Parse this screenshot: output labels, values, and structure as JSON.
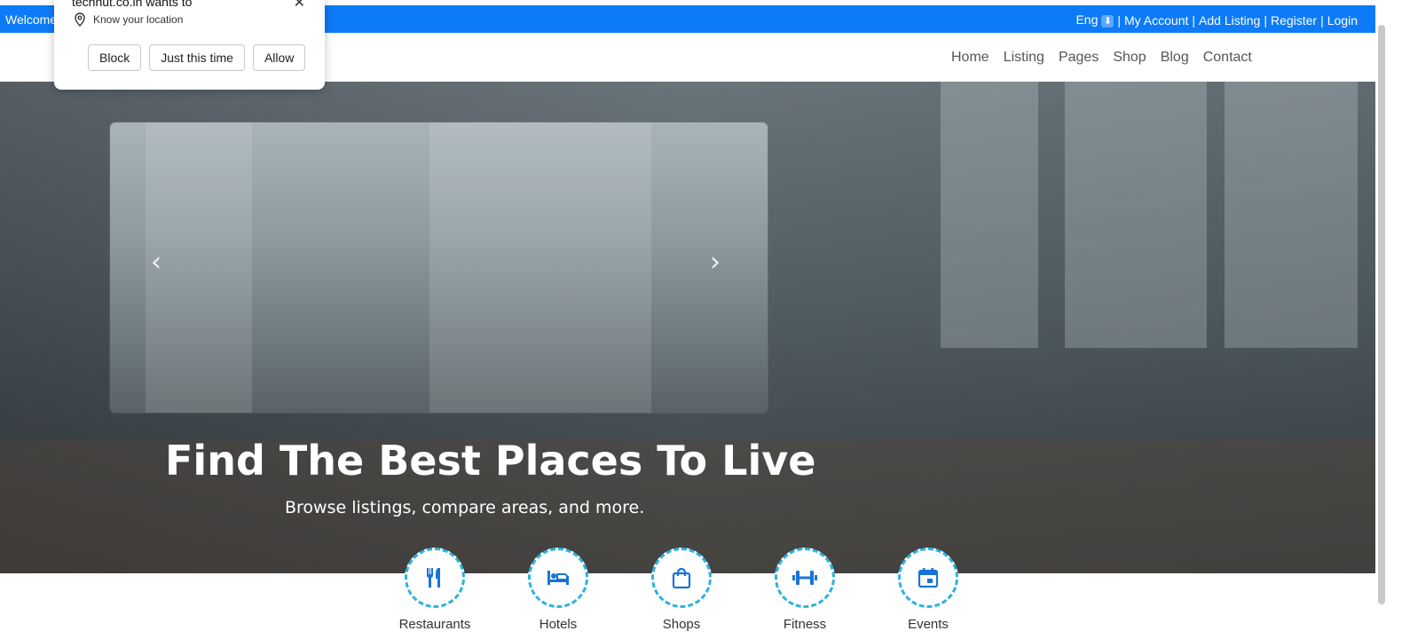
{
  "topbar": {
    "welcome": "Welcome",
    "lang": "Eng",
    "lang_icon": "download-icon",
    "links": [
      "My Account",
      "Add Listing",
      "Register",
      "Login"
    ],
    "separator": "|"
  },
  "nav": {
    "items": [
      "Home",
      "Listing",
      "Pages",
      "Shop",
      "Blog",
      "Contact"
    ]
  },
  "hero": {
    "title": "Find The Best Places To Live",
    "subtitle": "Browse listings, compare areas, and more."
  },
  "categories": [
    {
      "label": "Restaurants",
      "icon": "utensils-icon"
    },
    {
      "label": "Hotels",
      "icon": "bed-icon"
    },
    {
      "label": "Shops",
      "icon": "shopping-bag-icon"
    },
    {
      "label": "Fitness",
      "icon": "dumbbell-icon"
    },
    {
      "label": "Events",
      "icon": "calendar-icon"
    }
  ],
  "permission_popup": {
    "title": "technut.co.in wants to",
    "request": "Know your location",
    "buttons": [
      "Block",
      "Just this time",
      "Allow"
    ]
  },
  "colors": {
    "topbar_bg": "#0d7bf7",
    "accent_circle": "#2bb3de",
    "icon_blue": "#1a73d9"
  }
}
